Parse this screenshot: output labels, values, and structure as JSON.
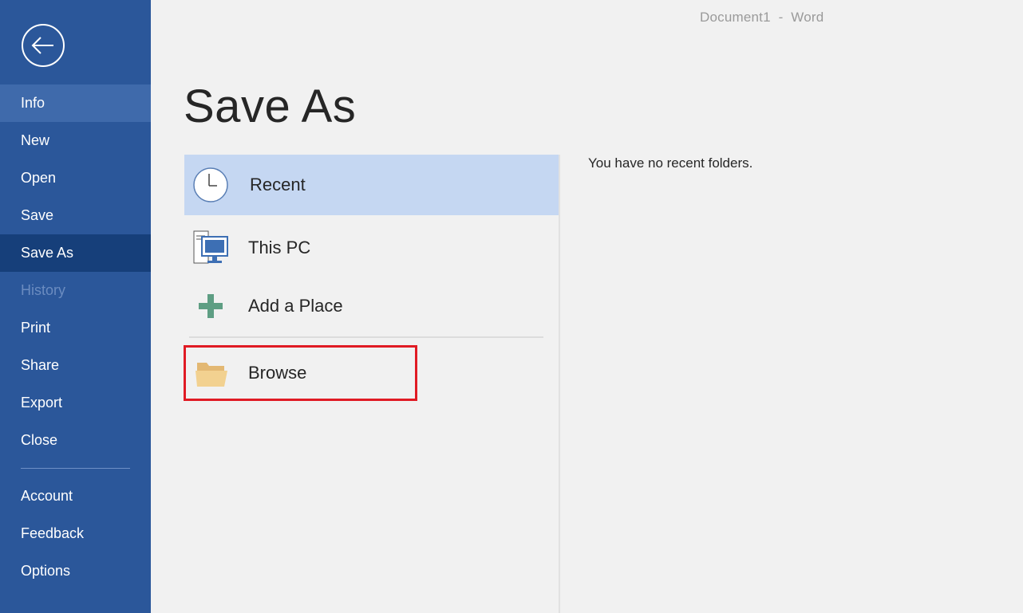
{
  "window": {
    "title": "Document1  -  Word"
  },
  "sidebar": {
    "back_icon": "back-arrow-icon",
    "items": [
      {
        "label": "Info",
        "state": "hover"
      },
      {
        "label": "New",
        "state": "normal"
      },
      {
        "label": "Open",
        "state": "normal"
      },
      {
        "label": "Save",
        "state": "normal"
      },
      {
        "label": "Save As",
        "state": "selected"
      },
      {
        "label": "History",
        "state": "disabled"
      },
      {
        "label": "Print",
        "state": "normal"
      },
      {
        "label": "Share",
        "state": "normal"
      },
      {
        "label": "Export",
        "state": "normal"
      },
      {
        "label": "Close",
        "state": "normal"
      }
    ],
    "bottom_items": [
      {
        "label": "Account"
      },
      {
        "label": "Feedback"
      },
      {
        "label": "Options"
      }
    ]
  },
  "main": {
    "title": "Save As",
    "locations": [
      {
        "label": "Recent",
        "icon": "clock-icon",
        "selected": true
      },
      {
        "label": "This PC",
        "icon": "computer-icon",
        "selected": false
      },
      {
        "label": "Add a Place",
        "icon": "plus-icon",
        "selected": false
      }
    ],
    "browse": {
      "label": "Browse",
      "icon": "folder-icon",
      "highlighted": true
    },
    "recent_message": "You have no recent folders."
  },
  "colors": {
    "sidebar_bg": "#2b579a",
    "sidebar_selected": "#163f7a",
    "sidebar_hover": "#3f6aab",
    "recent_selected_bg": "#c5d7f2",
    "highlight_border": "#e01b24"
  }
}
